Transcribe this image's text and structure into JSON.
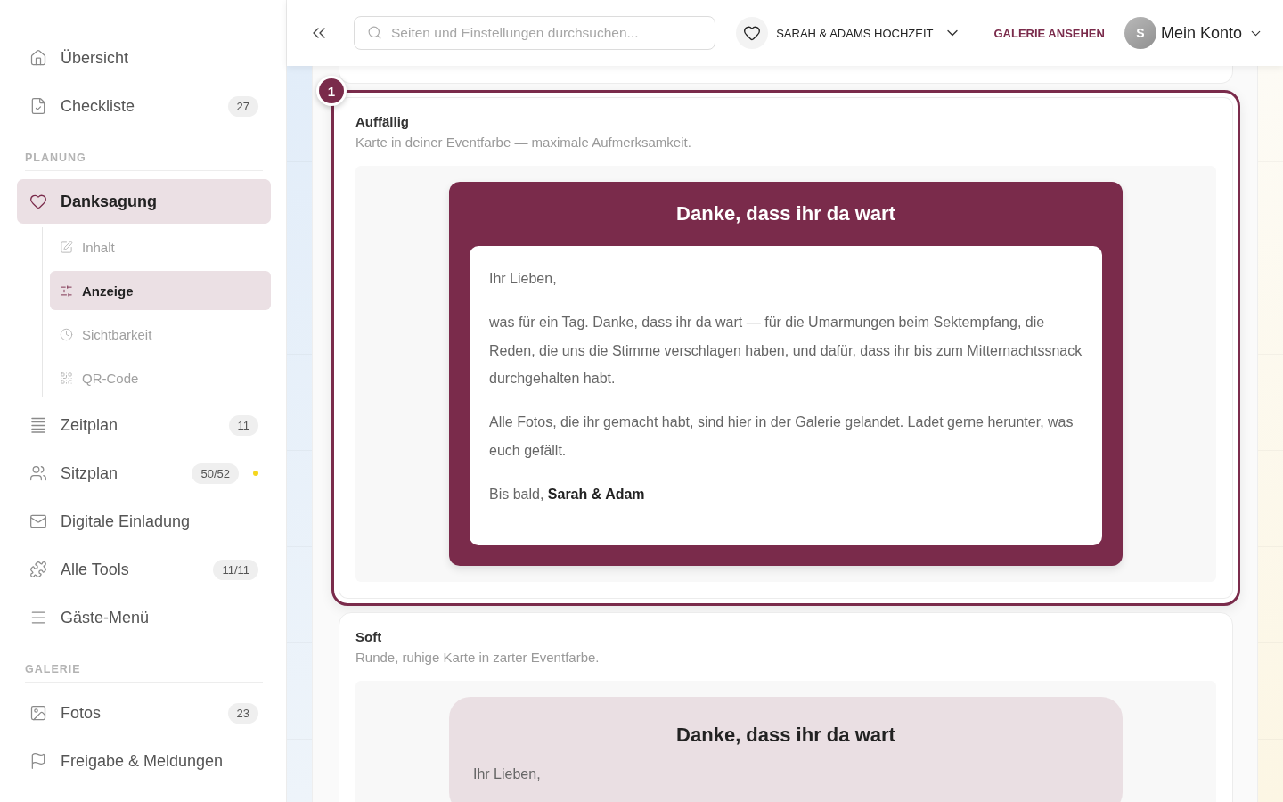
{
  "sidebar": {
    "groups": [
      {
        "items": [
          {
            "label": "Übersicht",
            "selected": false,
            "status_dot": false
          },
          {
            "label": "Checkliste",
            "count": "27",
            "selected": false,
            "status_dot": false
          }
        ]
      },
      {
        "heading": "PLANUNG",
        "items": [
          {
            "label": "Danksagung",
            "selected": true,
            "status_dot": false,
            "children": [
              {
                "label": "Inhalt",
                "selected": false
              },
              {
                "label": "Anzeige",
                "selected": true
              },
              {
                "label": "Sichtbarkeit",
                "selected": false
              },
              {
                "label": "QR-Code",
                "selected": false
              }
            ]
          },
          {
            "label": "Zeitplan",
            "count": "11",
            "selected": false,
            "status_dot": false
          },
          {
            "label": "Sitzplan",
            "count": "50/52",
            "selected": false,
            "status_dot": true
          },
          {
            "label": "Digitale Einladung",
            "selected": false,
            "status_dot": false
          },
          {
            "label": "Alle Tools",
            "count": "11/11",
            "selected": false,
            "status_dot": false
          },
          {
            "label": "Gäste-Menü",
            "selected": false,
            "status_dot": false
          }
        ]
      },
      {
        "heading": "GALERIE",
        "items": [
          {
            "label": "Fotos",
            "count": "23",
            "selected": false,
            "status_dot": false
          },
          {
            "label": "Freigabe & Meldungen",
            "selected": false,
            "status_dot": false
          }
        ]
      }
    ]
  },
  "topbar": {
    "search": {
      "placeholder": "Seiten und Einstellungen durchsuchen..."
    },
    "event": {
      "name": "SARAH & ADAMS HOCHZEIT"
    },
    "gallery_link": "GALERIE ANSEHEN",
    "account": {
      "initial": "S",
      "label": "Mein Konto"
    }
  },
  "styles": [
    {
      "kind": "bold",
      "badge": "1",
      "selected": true,
      "title": "Auffällig",
      "description": "Karte in deiner Eventfarbe — maximale Aufmerksamkeit.",
      "preview": {
        "heading": "Danke, dass ihr da wart",
        "paragraphs": [
          "Ihr Lieben,",
          "was für ein Tag. Danke, dass ihr da wart — für die Umarmungen beim Sektempfang, die Reden, die uns die Stimme verschlagen haben, und dafür, dass ihr bis zum Mitternachtssnack durchgehalten habt.",
          "Alle Fotos, die ihr gemacht habt, sind hier in der Galerie gelandet. Ladet gerne herunter, was euch gefällt.",
          "Bis bald, **Sarah & Adam**"
        ]
      }
    },
    {
      "kind": "soft",
      "selected": false,
      "title": "Soft",
      "description": "Runde, ruhige Karte in zarter Eventfarbe.",
      "preview": {
        "heading": "Danke, dass ihr da wart",
        "paragraphs": [
          "Ihr Lieben,"
        ]
      }
    }
  ]
}
